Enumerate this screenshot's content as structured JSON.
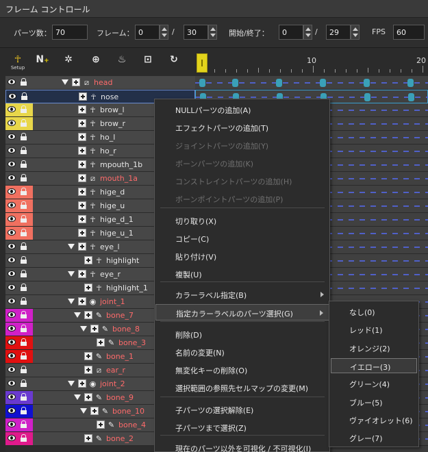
{
  "window": {
    "title": "フレーム コントロール"
  },
  "params": {
    "parts_label": "パーツ数：",
    "parts_value": "70",
    "frame_label": "フレーム：",
    "frame_value": "0",
    "frame_sep": "/",
    "frame_total": "30",
    "range_label": "開始/終了：",
    "start_value": "0",
    "range_sep": "/",
    "end_value": "29",
    "fps_label": "FPS",
    "fps_value": "60"
  },
  "toolbar": {
    "setup_label": "Setup",
    "tools": [
      "setup-icon",
      "add-null-icon",
      "add-effect-icon",
      "add-joint-icon",
      "add-bone-icon",
      "bake-icon",
      "rotate-icon"
    ]
  },
  "ruler": {
    "mark_10": "10",
    "mark_20": "20"
  },
  "colors": {
    "yellow": "#e8d64a",
    "salmon": "#f07060",
    "magenta": "#d020c8",
    "red": "#e01010",
    "blue": "#1010d0",
    "violet": "#6a3ad0",
    "pink": "#e01a8c",
    "key": "#3aa0b8"
  },
  "tree": {
    "rows": [
      {
        "name": "head",
        "red": true,
        "indent": 0,
        "tri": true,
        "icon": "null-icon",
        "label": ""
      },
      {
        "name": "nose",
        "red": false,
        "indent": 1,
        "tri": false,
        "icon": "effect-icon",
        "label": "",
        "selected": true
      },
      {
        "name": "brow_l",
        "red": false,
        "indent": 1,
        "tri": false,
        "icon": "effect-icon",
        "label": "yellow"
      },
      {
        "name": "brow_r",
        "red": false,
        "indent": 1,
        "tri": false,
        "icon": "effect-icon",
        "label": "yellow"
      },
      {
        "name": "ho_l",
        "red": false,
        "indent": 1,
        "tri": false,
        "icon": "effect-icon",
        "label": ""
      },
      {
        "name": "ho_r",
        "red": false,
        "indent": 1,
        "tri": false,
        "icon": "effect-icon",
        "label": ""
      },
      {
        "name": "mpouth_1b",
        "red": false,
        "indent": 1,
        "tri": false,
        "icon": "effect-icon",
        "label": ""
      },
      {
        "name": "mouth_1a",
        "red": true,
        "indent": 1,
        "tri": false,
        "icon": "null-icon",
        "label": ""
      },
      {
        "name": "hige_d",
        "red": false,
        "indent": 1,
        "tri": false,
        "icon": "effect-icon",
        "label": "salmon"
      },
      {
        "name": "hige_u",
        "red": false,
        "indent": 1,
        "tri": false,
        "icon": "effect-icon",
        "label": "salmon"
      },
      {
        "name": "hige_d_1",
        "red": false,
        "indent": 1,
        "tri": false,
        "icon": "effect-icon",
        "label": "salmon"
      },
      {
        "name": "hige_u_1",
        "red": false,
        "indent": 1,
        "tri": false,
        "icon": "effect-icon",
        "label": "salmon"
      },
      {
        "name": "eye_l",
        "red": false,
        "indent": 1,
        "tri": true,
        "icon": "effect-icon",
        "label": ""
      },
      {
        "name": "highlight",
        "red": false,
        "indent": 2,
        "tri": false,
        "icon": "effect-icon",
        "label": ""
      },
      {
        "name": "eye_r",
        "red": false,
        "indent": 1,
        "tri": true,
        "icon": "effect-icon",
        "label": ""
      },
      {
        "name": "highlight_1",
        "red": false,
        "indent": 2,
        "tri": false,
        "icon": "effect-icon",
        "label": ""
      },
      {
        "name": "joint_1",
        "red": true,
        "indent": 1,
        "tri": true,
        "icon": "joint-icon",
        "label": ""
      },
      {
        "name": "bone_7",
        "red": true,
        "indent": 2,
        "tri": true,
        "icon": "bone-icon",
        "label": "magenta"
      },
      {
        "name": "bone_8",
        "red": true,
        "indent": 3,
        "tri": true,
        "icon": "bone-icon",
        "label": "magenta"
      },
      {
        "name": "bone_3",
        "red": true,
        "indent": 4,
        "tri": false,
        "icon": "bone-icon",
        "label": "red"
      },
      {
        "name": "bone_1",
        "red": true,
        "indent": 2,
        "tri": false,
        "icon": "bone-icon",
        "label": "red"
      },
      {
        "name": "ear_r",
        "red": true,
        "indent": 2,
        "tri": false,
        "icon": "null-icon",
        "label": ""
      },
      {
        "name": "joint_2",
        "red": true,
        "indent": 1,
        "tri": true,
        "icon": "joint-icon",
        "label": ""
      },
      {
        "name": "bone_9",
        "red": true,
        "indent": 2,
        "tri": true,
        "icon": "bone-icon",
        "label": "violet"
      },
      {
        "name": "bone_10",
        "red": true,
        "indent": 3,
        "tri": true,
        "icon": "bone-icon",
        "label": "blue"
      },
      {
        "name": "bone_4",
        "red": true,
        "indent": 4,
        "tri": false,
        "icon": "bone-icon",
        "label": "magenta"
      },
      {
        "name": "bone_2",
        "red": true,
        "indent": 2,
        "tri": false,
        "icon": "bone-icon",
        "label": "pink"
      }
    ]
  },
  "context_menu": {
    "items": [
      {
        "label": "NULLパーツの追加(A)",
        "disabled": false
      },
      {
        "label": "エフェクトパーツの追加(T)",
        "disabled": false
      },
      {
        "label": "ジョイントパーツの追加(Y)",
        "disabled": true
      },
      {
        "label": "ボーンパーツの追加(K)",
        "disabled": true
      },
      {
        "label": "コンストレイントパーツの追加(H)",
        "disabled": true
      },
      {
        "label": "ボーンポイントパーツの追加(P)",
        "disabled": true
      },
      {
        "label": "切り取り(X)",
        "disabled": false
      },
      {
        "label": "コピー(C)",
        "disabled": false
      },
      {
        "label": "貼り付け(V)",
        "disabled": false
      },
      {
        "label": "複製(U)",
        "disabled": false
      },
      {
        "label": "カラーラベル指定(B)",
        "disabled": false,
        "submenu": true
      },
      {
        "label": "指定カラーラベルのパーツ選択(G)",
        "disabled": false,
        "submenu": true,
        "highlight": true
      },
      {
        "label": "削除(D)",
        "disabled": false
      },
      {
        "label": "名前の変更(N)",
        "disabled": false
      },
      {
        "label": "無変化キーの削除(O)",
        "disabled": false
      },
      {
        "label": "選択範囲の参照先セルマップの変更(M)",
        "disabled": false
      },
      {
        "label": "子パーツの選択解除(E)",
        "disabled": false
      },
      {
        "label": "子パーツまで選択(Z)",
        "disabled": false
      },
      {
        "label": "現在のパーツ以外を可視化 / 不可視化(I)",
        "disabled": false
      }
    ]
  },
  "submenu": {
    "items": [
      {
        "label": "なし(0)"
      },
      {
        "label": "レッド(1)"
      },
      {
        "label": "オレンジ(2)"
      },
      {
        "label": "イエロー(3)",
        "highlight": true
      },
      {
        "label": "グリーン(4)"
      },
      {
        "label": "ブルー(5)"
      },
      {
        "label": "ヴァイオレット(6)"
      },
      {
        "label": "グレー(7)"
      }
    ]
  }
}
